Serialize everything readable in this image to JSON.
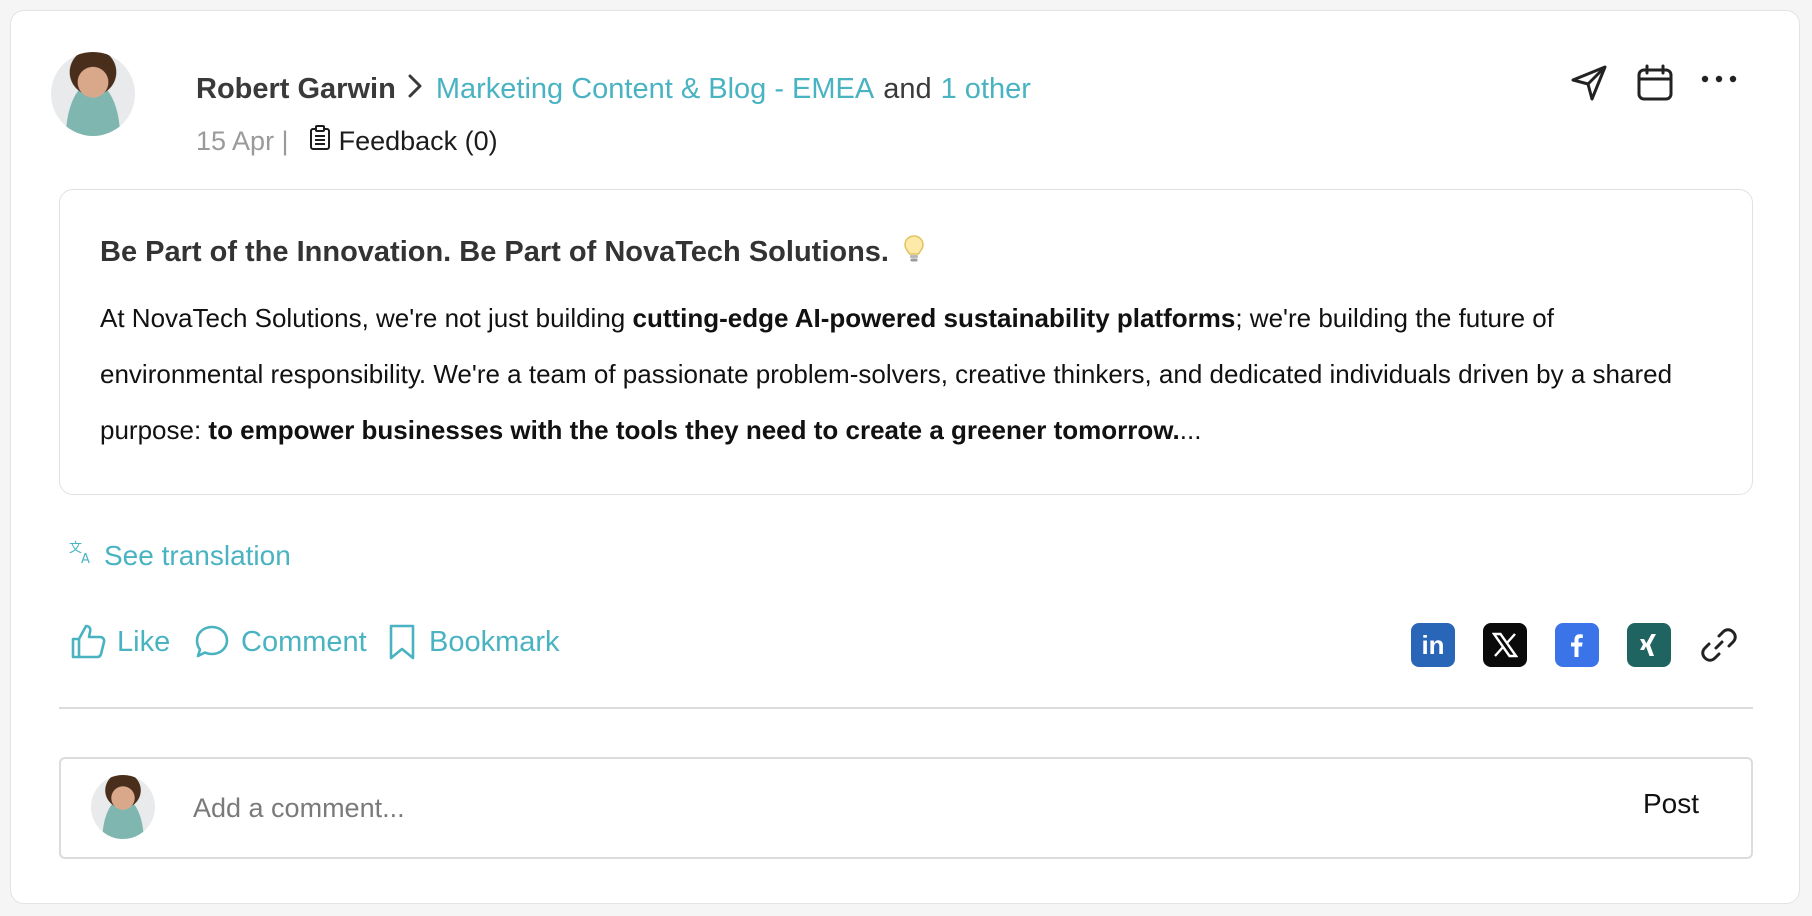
{
  "post": {
    "author": "Robert Garwin",
    "groups": [
      "Marketing Content & Blog - EMEA"
    ],
    "and_text": "and",
    "other_text": "1 other",
    "date": "15 Apr |",
    "feedback": "Feedback (0)",
    "title": "Be Part of the Innovation. Be Part of NovaTech Solutions.",
    "body": {
      "part1": "At NovaTech Solutions, we're not just building ",
      "bold1": "cutting-edge AI-powered sustainability platforms",
      "part2": "; we're building the future of environmental responsibility. We're a team of passionate problem-solvers, creative thinkers, and dedicated individuals driven by a shared purpose: ",
      "bold2": "to empower businesses with the tools they need to create a greener tomorrow.",
      "ellipsis": "..."
    },
    "see_translation": "See translation"
  },
  "actions": {
    "like": "Like",
    "comment": "Comment",
    "bookmark": "Bookmark"
  },
  "share": {
    "linkedin_text": "in",
    "facebook_text": "f"
  },
  "comment_box": {
    "placeholder": "Add a comment...",
    "post_label": "Post"
  },
  "icons": {
    "send": "send-icon",
    "calendar": "calendar-icon",
    "more": "more-icon",
    "feedback": "clipboard-icon",
    "translate": "translate-icon",
    "like": "thumbs-up-icon",
    "comment": "comment-bubble-icon",
    "bookmark": "bookmark-icon",
    "link": "link-icon",
    "bulb": "lightbulb-icon"
  },
  "colors": {
    "accent": "#49b3c2",
    "linkedin": "#2a66b8",
    "x": "#0a0a0a",
    "facebook": "#3a74e8",
    "xing": "#1f6460"
  }
}
